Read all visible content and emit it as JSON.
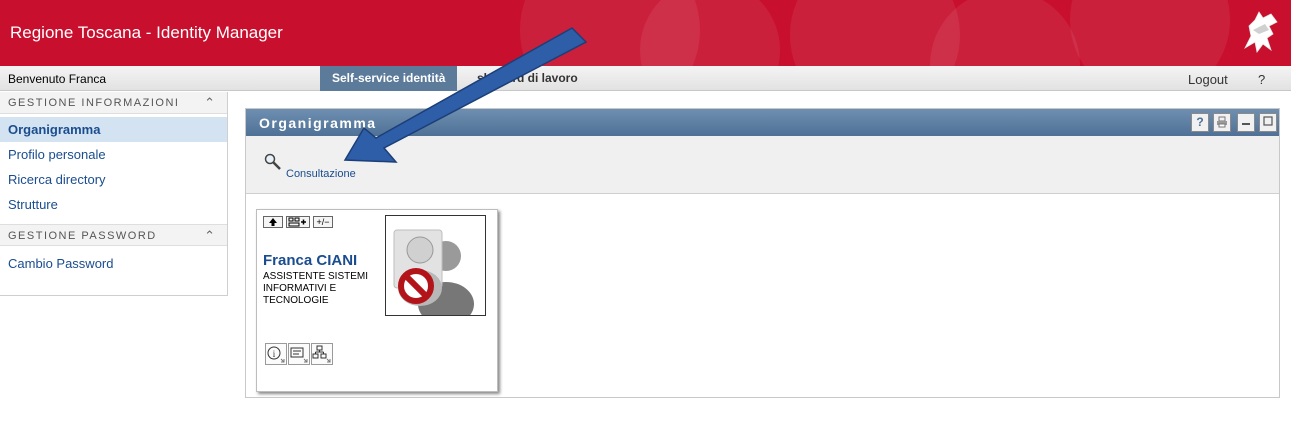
{
  "header": {
    "title": "Regione Toscana - Identity Manager",
    "logo_icon": "pegasus-logo-icon",
    "bg_color": "#c8102e"
  },
  "topbar": {
    "welcome": "Benvenuto Franca",
    "tabs": [
      {
        "label": "Self-service identità",
        "active": true
      },
      {
        "label": "Dashboard di lavoro",
        "visible_label": "shboard di lavoro",
        "active": false
      }
    ],
    "logout": "Logout",
    "help": "?"
  },
  "sidebar": {
    "sections": [
      {
        "title": "GESTIONE INFORMAZIONI",
        "collapse_icon": "chevron-up-double-icon",
        "items": [
          {
            "label": "Organigramma",
            "selected": true
          },
          {
            "label": "Profilo personale",
            "selected": false
          },
          {
            "label": "Ricerca directory",
            "selected": false
          },
          {
            "label": "Strutture",
            "selected": false
          }
        ]
      },
      {
        "title": "GESTIONE PASSWORD",
        "collapse_icon": "chevron-up-double-icon",
        "items": [
          {
            "label": "Cambio Password",
            "selected": false
          }
        ]
      }
    ]
  },
  "panel": {
    "title": "Organigramma",
    "controls": [
      "help-icon",
      "print-icon",
      "minimize-icon",
      "maximize-icon"
    ],
    "help_symbol": "?",
    "toolbar": {
      "action_label": "Consultazione",
      "action_icon": "magnifier-icon"
    }
  },
  "card": {
    "nav_buttons": [
      "up-arrow-icon",
      "expand-tree-icon",
      "+/−"
    ],
    "name": "Franca CIANI",
    "role": "ASSISTENTE SISTEMI INFORMATIVI E TECNOLOGIE",
    "photo_icon": "no-photo-users-icon",
    "actions": [
      "info-icon",
      "details-icon",
      "org-chart-icon"
    ]
  },
  "annotation": {
    "arrow_icon": "blue-arrow-annotation",
    "color": "#2e5ea8"
  }
}
